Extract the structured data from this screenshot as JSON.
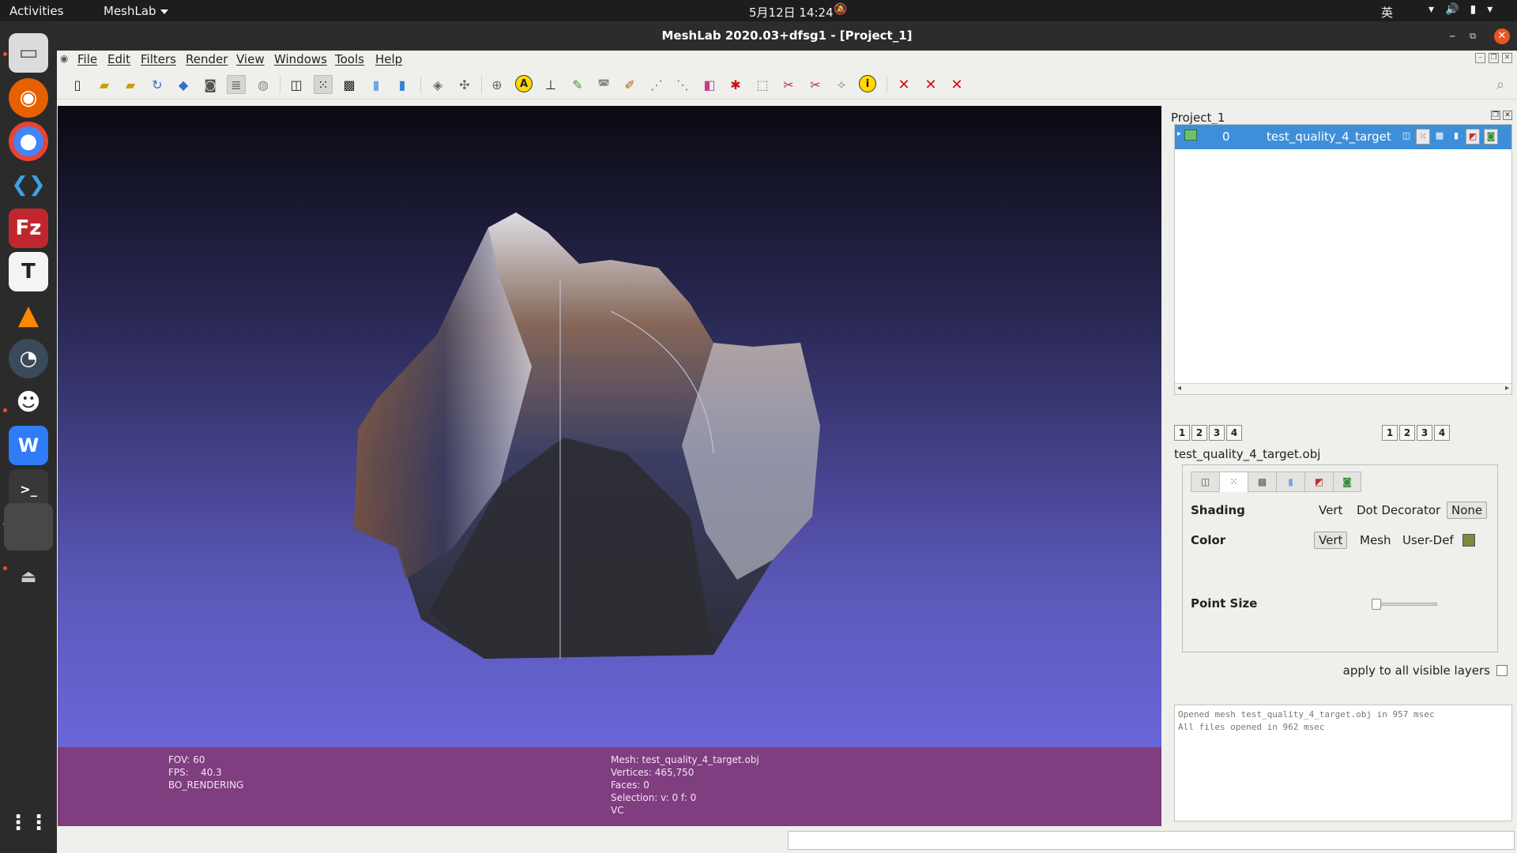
{
  "topbar": {
    "activities": "Activities",
    "app_name": "MeshLab",
    "clock": "5月12日  14:24",
    "ime": "英",
    "notif_icon": "bell-off-icon"
  },
  "dock": {
    "apps": [
      "files",
      "firefox",
      "chrome",
      "vscode",
      "filezilla",
      "typora",
      "vlc",
      "speedtest",
      "qq",
      "wps",
      "terminal",
      "meshlab",
      "usb-drive"
    ],
    "show_apps_icon": "grid-icon"
  },
  "window": {
    "title": "MeshLab 2020.03+dfsg1 - [Project_1]"
  },
  "menu": [
    "File",
    "Edit",
    "Filters",
    "Render",
    "View",
    "Windows",
    "Tools",
    "Help"
  ],
  "viewport": {
    "info_left": [
      "FOV: 60",
      "FPS:    40.3",
      "BO_RENDERING"
    ],
    "info_right": [
      "Mesh: test_quality_4_target.obj",
      "Vertices: 465,750",
      "Faces: 0",
      "Selection: v: 0 f: 0",
      "VC"
    ]
  },
  "panel": {
    "title": "Project_1",
    "layer": {
      "index": "0",
      "name": "test_quality_4_target"
    },
    "view_buttons_left": [
      "1",
      "2",
      "3",
      "4"
    ],
    "view_buttons_right": [
      "1",
      "2",
      "3",
      "4"
    ],
    "filename": "test_quality_4_target.obj",
    "shading_label": "Shading",
    "shading_options": [
      "Vert",
      "Dot Decorator",
      "None"
    ],
    "color_label": "Color",
    "color_options": [
      "Vert",
      "Mesh",
      "User-Def"
    ],
    "user_def_color": "#7a8c3a",
    "point_size_label": "Point Size",
    "apply_all_label": "apply to all visible layers",
    "log": [
      "Opened mesh test_quality_4_target.obj in 957 msec",
      "All files opened in 962 msec"
    ]
  }
}
